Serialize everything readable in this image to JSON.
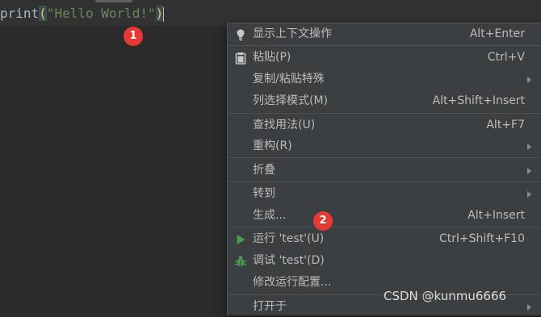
{
  "editor": {
    "code": {
      "fn": "print",
      "open_paren": "(",
      "string": "\"Hello World!\"",
      "close_paren": ")"
    }
  },
  "badges": [
    "1",
    "2"
  ],
  "context_menu": {
    "items": [
      {
        "label": "显示上下文操作",
        "shortcut": "Alt+Enter",
        "icon": "bulb-icon"
      },
      {
        "label": "粘贴(P)",
        "shortcut": "Ctrl+V",
        "icon": "clipboard-icon"
      },
      {
        "label": "复制/粘贴特殊",
        "shortcut": "",
        "submenu": true
      },
      {
        "label": "列选择模式(M)",
        "shortcut": "Alt+Shift+Insert"
      },
      {
        "label": "查找用法(U)",
        "shortcut": "Alt+F7"
      },
      {
        "label": "重构(R)",
        "shortcut": "",
        "submenu": true
      },
      {
        "label": "折叠",
        "shortcut": "",
        "submenu": true
      },
      {
        "label": "转到",
        "shortcut": "",
        "submenu": true
      },
      {
        "label": "生成...",
        "shortcut": "Alt+Insert"
      },
      {
        "label": "运行 'test'(U)",
        "shortcut": "Ctrl+Shift+F10",
        "icon": "run-icon"
      },
      {
        "label": "调试 'test'(D)",
        "shortcut": "",
        "icon": "debug-icon"
      },
      {
        "label": "修改运行配置...",
        "shortcut": ""
      },
      {
        "label": "打开于",
        "shortcut": "",
        "submenu": true
      }
    ]
  },
  "watermark": "CSDN @kunmu6666",
  "colors": {
    "editor_bg": "#2b2b2b",
    "menu_bg": "#3c3f41",
    "badge": "#e53935",
    "run_green": "#499c54"
  }
}
